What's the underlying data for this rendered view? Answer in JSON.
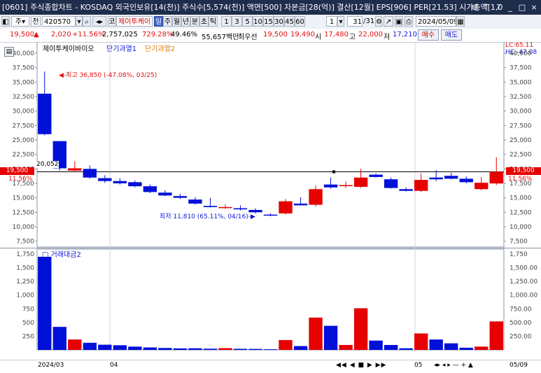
{
  "window": {
    "title": "[0601] 주식종합차트 - KOSDAQ 외국인보유[14(천)] 주식수[5,574(천)] 액면[500] 자본금[28(억)] 결산[12월] EPS[906] PER[21.53] 시가총액[1,0"
  },
  "toolbar": {
    "market": "주",
    "market_mode": "전",
    "code": "420570",
    "stock_prefix": "코",
    "stock_name": "제이투케이",
    "periods": [
      "일",
      "주",
      "월",
      "년",
      "분",
      "초",
      "틱"
    ],
    "selected_period": "일",
    "intervals": [
      "1",
      "3",
      "5",
      "10",
      "15",
      "30",
      "45",
      "60"
    ],
    "interval_value": "1",
    "count_value": "31",
    "count_total": "/31",
    "date": "2024/05/09"
  },
  "info": {
    "price": "19,500",
    "change_arrow": "▲",
    "change": "2,020",
    "change_pct": "+11.56%",
    "volume": "2,757,025",
    "vol_ratio": "729.28%",
    "turnover": "49.46%",
    "amount": "55,657백만",
    "best_ask_label": "최우선",
    "best_ask": "19,500",
    "best_bid": "19,490",
    "open_label": "시",
    "open": "17,480",
    "high_label": "고",
    "high": "22,000",
    "low_label": "저",
    "low": "17,210",
    "buy_button": "매수",
    "sell_button": "매도"
  },
  "colors": {
    "up": "#e60000",
    "down": "#0010d8",
    "bg": "#ffffff",
    "accent": "#ff0000"
  },
  "legend": {
    "name": "제이투케이바이오",
    "ma1": "단기과열1",
    "ma2": "단기과열2"
  },
  "right_top": {
    "lc": "LC:65.11",
    "hc": "HC:-47.08"
  },
  "price_axis": [
    "40,000",
    "37,500",
    "35,000",
    "32,500",
    "30,000",
    "27,500",
    "25,000",
    "22,500",
    "20,000",
    "17,500",
    "15,000",
    "12,500",
    "10,000",
    "7,500"
  ],
  "volume_axis": [
    "1,750",
    "1,500",
    "1,250",
    "1,000",
    "750",
    "500",
    "250"
  ],
  "right_volume_axis": [
    "1,750",
    "1,500.00",
    "1,250.00",
    "1,000.00",
    "750.00",
    "500.00",
    "250.00"
  ],
  "current_price_badge": "19,500",
  "current_change_badge": "11.56%",
  "ref_line_label": "20,052",
  "annotations": {
    "high": "최고 36,850 (-47.08%, 03/25)",
    "low": "최저 11,810 (65.11%, 04/16)"
  },
  "volume_label": "거래대금2",
  "x_labels": {
    "start": "2024/03",
    "m1": "04",
    "m2": "05",
    "end": "05/09"
  },
  "chart_data": {
    "type": "candlestick",
    "candles": [
      {
        "o": 26000,
        "h": 36850,
        "l": 25800,
        "c": 33000,
        "up": false,
        "vol": 1700
      },
      {
        "o": 24800,
        "h": 24800,
        "l": 19700,
        "c": 20100,
        "up": false,
        "vol": 420
      },
      {
        "o": 20100,
        "h": 21300,
        "l": 19500,
        "c": 19700,
        "up": true,
        "vol": 190
      },
      {
        "o": 20000,
        "h": 20600,
        "l": 18300,
        "c": 18500,
        "up": false,
        "vol": 130
      },
      {
        "o": 18400,
        "h": 18900,
        "l": 17600,
        "c": 17900,
        "up": false,
        "vol": 95
      },
      {
        "o": 17900,
        "h": 18400,
        "l": 17300,
        "c": 17500,
        "up": false,
        "vol": 85
      },
      {
        "o": 17700,
        "h": 18000,
        "l": 16800,
        "c": 17000,
        "up": false,
        "vol": 60
      },
      {
        "o": 17000,
        "h": 17300,
        "l": 15800,
        "c": 16000,
        "up": false,
        "vol": 45
      },
      {
        "o": 15900,
        "h": 16300,
        "l": 15300,
        "c": 15400,
        "up": false,
        "vol": 35
      },
      {
        "o": 15300,
        "h": 15700,
        "l": 14800,
        "c": 15000,
        "up": false,
        "vol": 28
      },
      {
        "o": 14700,
        "h": 15100,
        "l": 13800,
        "c": 14000,
        "up": false,
        "vol": 30
      },
      {
        "o": 13600,
        "h": 15000,
        "l": 13300,
        "c": 13400,
        "up": false,
        "vol": 22
      },
      {
        "o": 13400,
        "h": 13900,
        "l": 13100,
        "c": 13300,
        "up": true,
        "vol": 32
      },
      {
        "o": 13200,
        "h": 13700,
        "l": 12800,
        "c": 13000,
        "up": false,
        "vol": 20
      },
      {
        "o": 12900,
        "h": 13200,
        "l": 12300,
        "c": 12500,
        "up": false,
        "vol": 18
      },
      {
        "o": 12100,
        "h": 12300,
        "l": 11810,
        "c": 12000,
        "up": false,
        "vol": 12
      },
      {
        "o": 12300,
        "h": 14800,
        "l": 12100,
        "c": 14400,
        "up": true,
        "vol": 180
      },
      {
        "o": 14000,
        "h": 15100,
        "l": 13700,
        "c": 13700,
        "up": false,
        "vol": 70
      },
      {
        "o": 13800,
        "h": 17100,
        "l": 13500,
        "c": 16500,
        "up": true,
        "vol": 590
      },
      {
        "o": 17300,
        "h": 18500,
        "l": 16600,
        "c": 16800,
        "up": false,
        "vol": 440
      },
      {
        "o": 17100,
        "h": 17800,
        "l": 16700,
        "c": 17200,
        "up": true,
        "vol": 90
      },
      {
        "o": 16900,
        "h": 20000,
        "l": 16700,
        "c": 18500,
        "up": true,
        "vol": 760
      },
      {
        "o": 19000,
        "h": 19200,
        "l": 18500,
        "c": 18600,
        "up": false,
        "vol": 170
      },
      {
        "o": 18200,
        "h": 18500,
        "l": 16600,
        "c": 16700,
        "up": false,
        "vol": 90
      },
      {
        "o": 16500,
        "h": 16800,
        "l": 16100,
        "c": 16200,
        "up": false,
        "vol": 30
      },
      {
        "o": 16200,
        "h": 19200,
        "l": 16000,
        "c": 18100,
        "up": true,
        "vol": 300
      },
      {
        "o": 18500,
        "h": 19800,
        "l": 17900,
        "c": 18200,
        "up": false,
        "vol": 190
      },
      {
        "o": 18800,
        "h": 19300,
        "l": 18200,
        "c": 18300,
        "up": false,
        "vol": 120
      },
      {
        "o": 18300,
        "h": 18700,
        "l": 17500,
        "c": 17700,
        "up": false,
        "vol": 40
      },
      {
        "o": 16500,
        "h": 18600,
        "l": 16300,
        "c": 17600,
        "up": true,
        "vol": 60
      },
      {
        "o": 17480,
        "h": 22000,
        "l": 17210,
        "c": 19500,
        "up": true,
        "vol": 520
      }
    ],
    "price_range": [
      7500,
      40000
    ],
    "volume_range": [
      0,
      1750
    ]
  }
}
